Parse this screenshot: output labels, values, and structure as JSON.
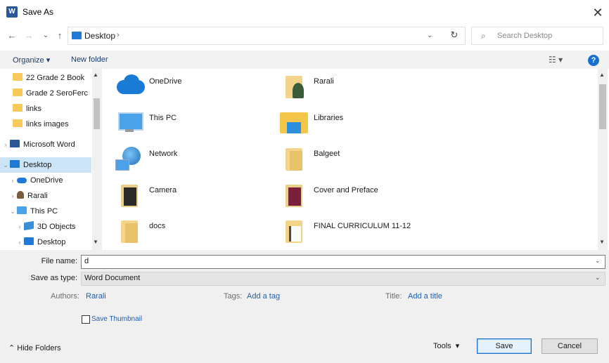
{
  "window": {
    "title": "Save As",
    "close_label": "✕",
    "app_icon": "word-icon"
  },
  "navigation": {
    "back": "←",
    "forward": "→",
    "recent": "⌄",
    "up": "↑",
    "path_label": "Desktop",
    "path_separator": "›",
    "path_dropdown": "⌄",
    "refresh": "↻",
    "search_placeholder": "Search Desktop"
  },
  "toolbar": {
    "organize_label": "Organize ▾",
    "new_folder_label": "New folder",
    "view_label": "☷ ▾",
    "help_label": "?"
  },
  "sidebar": {
    "items": [
      {
        "label": "22 Grade 2 Book",
        "icon": "folder-icon",
        "chevron": ""
      },
      {
        "label": "Grade 2 SeroFerc",
        "icon": "folder-icon",
        "chevron": ""
      },
      {
        "label": "links",
        "icon": "folder-icon",
        "chevron": ""
      },
      {
        "label": "links images",
        "icon": "folder-icon",
        "chevron": ""
      },
      {
        "label": "Microsoft Word",
        "icon": "word-icon",
        "chevron": "›"
      },
      {
        "label": "Desktop",
        "icon": "desktop-icon",
        "chevron": "⌄"
      },
      {
        "label": "OneDrive",
        "icon": "cloud-icon",
        "chevron": "›"
      },
      {
        "label": "Rarali",
        "icon": "user-icon",
        "chevron": "›"
      },
      {
        "label": "This PC",
        "icon": "pc-icon",
        "chevron": "⌄"
      },
      {
        "label": "3D Objects",
        "icon": "cube-icon",
        "chevron": "›"
      },
      {
        "label": "Desktop",
        "icon": "desktop-icon",
        "chevron": "›"
      }
    ]
  },
  "files": [
    {
      "label": "OneDrive",
      "icon": "onedrive-icon"
    },
    {
      "label": "Rarali",
      "icon": "user-folder-icon"
    },
    {
      "label": "This PC",
      "icon": "pc-icon"
    },
    {
      "label": "Libraries",
      "icon": "libraries-icon"
    },
    {
      "label": "Network",
      "icon": "network-icon"
    },
    {
      "label": "Balgeet",
      "icon": "folder-icon"
    },
    {
      "label": "Camera",
      "icon": "folder-icon"
    },
    {
      "label": "Cover and Preface",
      "icon": "folder-icon"
    },
    {
      "label": "docs",
      "icon": "folder-icon"
    },
    {
      "label": "FINAL CURRICULUM 11-12",
      "icon": "folder-icon"
    }
  ],
  "form": {
    "file_name_label": "File name:",
    "file_name_value": "d",
    "save_type_label": "Save as type:",
    "save_type_value": "Word Document",
    "authors_label": "Authors:",
    "authors_value": "Rarali",
    "tags_label": "Tags:",
    "tags_value": "Add a tag",
    "title_label": "Title:",
    "title_value": "Add a title",
    "thumbnail_label": "Save Thumbnail",
    "thumbnail_checked": false
  },
  "footer": {
    "hide_folders_label": "Hide Folders",
    "tools_label": "Tools",
    "save_label": "Save",
    "cancel_label": "Cancel"
  }
}
